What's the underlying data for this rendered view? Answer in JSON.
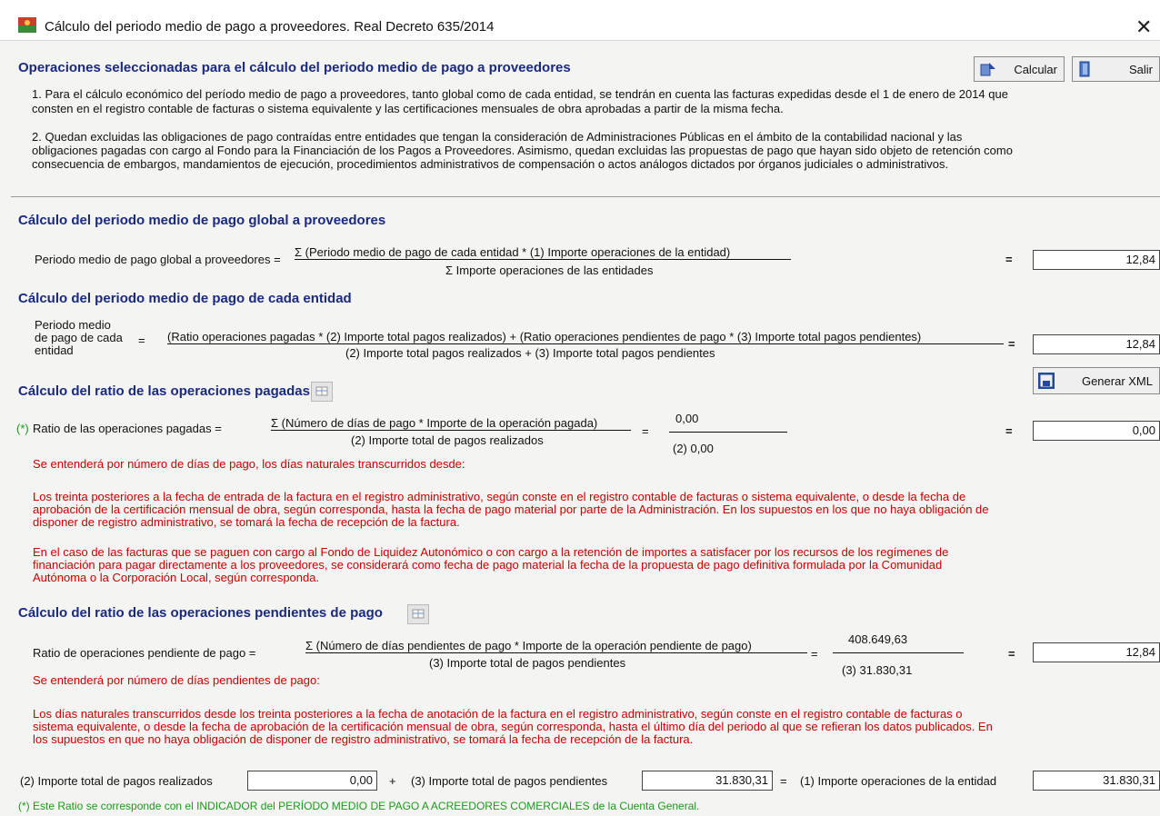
{
  "window": {
    "title": "Cálculo del periodo medio de pago a proveedores. Real Decreto 635/2014",
    "close_glyph": "✕"
  },
  "buttons": {
    "calcular": "Calcular",
    "salir": "Salir",
    "generar_xml": "Generar XML"
  },
  "intro": {
    "heading": "Operaciones seleccionadas para el cálculo del periodo medio de pago a proveedores",
    "p1_lines": [
      "1. Para el cálculo económico del período medio de pago a proveedores, tanto global como de cada entidad, se tendrán en cuenta las facturas expedidas desde el 1 de enero de 2014 que",
      "consten en el registro contable de facturas o sistema equivalente y las certificaciones mensuales de obra aprobadas a partir de la misma fecha."
    ],
    "p2_lines": [
      "2. Quedan excluidas las obligaciones de pago contraídas entre entidades que tengan la consideración de Administraciones Públicas en el ámbito de la contabilidad nacional y las",
      "obligaciones pagadas con cargo al Fondo para la Financiación de los Pagos a Proveedores. Asimismo, quedan excluidas las propuestas de pago que hayan sido objeto de retención como",
      "consecuencia de embargos, mandamientos de ejecución, procedimientos administrativos de compensación o actos análogos dictados por órganos judiciales o administrativos."
    ]
  },
  "global": {
    "heading": "Cálculo del periodo medio de pago global a proveedores",
    "label": "Periodo medio de pago global a proveedores =",
    "numerator": "Σ (Periodo medio de pago de cada entidad * (1) Importe operaciones de la entidad)",
    "denominator": "Σ Importe operaciones de las entidades",
    "equals": "=",
    "value": "12,84"
  },
  "entidad": {
    "heading": "Cálculo del periodo medio de pago de cada entidad",
    "label_lines": [
      "Periodo medio",
      "de pago de cada",
      "entidad"
    ],
    "label_eq": "=",
    "numerator": "(Ratio operaciones pagadas * (2) Importe total pagos realizados) + (Ratio operaciones pendientes de pago * (3) Importe total pagos pendientes)",
    "denominator": "(2) Importe total pagos realizados + (3) Importe total pagos pendientes",
    "equals": "=",
    "value": "12,84"
  },
  "pagadas": {
    "heading": "Cálculo del ratio de las operaciones pagadas",
    "marker": "(*)",
    "label": "Ratio de las operaciones pagadas =",
    "numerator": "Σ (Número de días de pago * Importe de la operación pagada)",
    "denominator": "(2) Importe total de pagos realizados",
    "eq1": "=",
    "num_value": "0,00",
    "den_value": "(2) 0,00",
    "equals": "=",
    "value": "0,00",
    "note": "Se entenderá por número de días de pago, los días naturales transcurridos desde:",
    "p1_lines": [
      "Los treinta posteriores a la fecha de entrada de la factura en el registro administrativo, según conste en el registro contable de facturas o sistema equivalente, o desde la fecha de",
      "aprobación de la certificación mensual de obra, según corresponda, hasta la fecha de pago material por parte de la Administración. En los supuestos en los que no haya obligación de",
      "disponer de registro administrativo, se tomará la fecha de recepción de la factura."
    ],
    "p2_lines": [
      "En el caso de las facturas que se paguen con cargo al Fondo de Liquidez Autonómico o con cargo a la retención de importes a satisfacer por los recursos de los regímenes de",
      "financiación para pagar directamente a los proveedores, se considerará como fecha de pago material la fecha de la propuesta de pago definitiva formulada por la Comunidad",
      "Autónoma o la Corporación Local, según corresponda."
    ]
  },
  "pendientes": {
    "heading": "Cálculo del ratio de las operaciones pendientes de pago",
    "label": "Ratio de operaciones pendiente de pago =",
    "numerator": "Σ (Número de días pendientes de pago * Importe de la operación pendiente de pago)",
    "denominator": "(3) Importe total de pagos pendientes",
    "eq1": "=",
    "num_value": "408.649,63",
    "den_value": "(3) 31.830,31",
    "equals": "=",
    "value": "12,84",
    "note": "Se entenderá por número de días pendientes de pago:",
    "p_lines": [
      "Los días naturales transcurridos desde los treinta posteriores a la fecha de anotación de la factura en el registro administrativo, según conste en el registro contable de facturas o",
      "sistema equivalente, o desde la fecha de aprobación de la certificación mensual de obra, según corresponda, hasta el último día del periodo al que se refieran los datos publicados. En",
      "los supuestos en que no haya obligación de disponer de registro administrativo, se tomará la fecha de recepción de la factura."
    ]
  },
  "totales": {
    "pagos_realizados_label": "(2) Importe total de pagos realizados",
    "pagos_realizados_value": "0,00",
    "plus": "+",
    "pagos_pendientes_label": "(3) Importe total de pagos pendientes",
    "pagos_pendientes_value": "31.830,31",
    "equals": "=",
    "operaciones_label": "(1) Importe operaciones de la entidad",
    "operaciones_value": "31.830,31"
  },
  "footer_note": "(*) Este Ratio se corresponde con el INDICADOR del PERÍODO MEDIO DE PAGO A ACREEDORES COMERCIALES de la Cuenta General.",
  "colors": {
    "heading": "#1a2a80",
    "note_red": "#cc0000",
    "note_green": "#1a9b1a"
  }
}
